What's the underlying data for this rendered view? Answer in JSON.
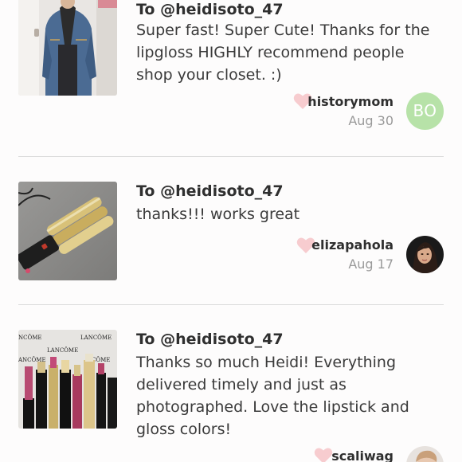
{
  "reviews": [
    {
      "to": "To @heidisoto_47",
      "message": "Super fast! Super Cute! Thanks for the lipgloss HIGHLY recommend people shop your closet. :)",
      "username": "historymom",
      "date": "Aug 30",
      "avatar_initials": "BO",
      "thumb_icon": "denim-jacket-photo"
    },
    {
      "to": "To @heidisoto_47",
      "message": "thanks!!! works great",
      "username": "elizapahola",
      "date": "Aug 17",
      "thumb_icon": "curling-iron-photo"
    },
    {
      "to": "To @heidisoto_47",
      "message": "Thanks so much Heidi! Everything delivered timely and just as photographed. Love the lipstick and gloss colors!",
      "username": "scaliwag",
      "thumb_icon": "lancome-lipstick-photo",
      "thumb_brand_text": [
        "NCÔME",
        "LANCÔME",
        "LANCÔME",
        "ANCÔME",
        "CÔME"
      ]
    }
  ],
  "colors": {
    "heart": "#f7cccf",
    "avatar_bg": "#b7e2a8",
    "divider": "#dcdcdc",
    "muted_text": "#9a9a9a"
  }
}
